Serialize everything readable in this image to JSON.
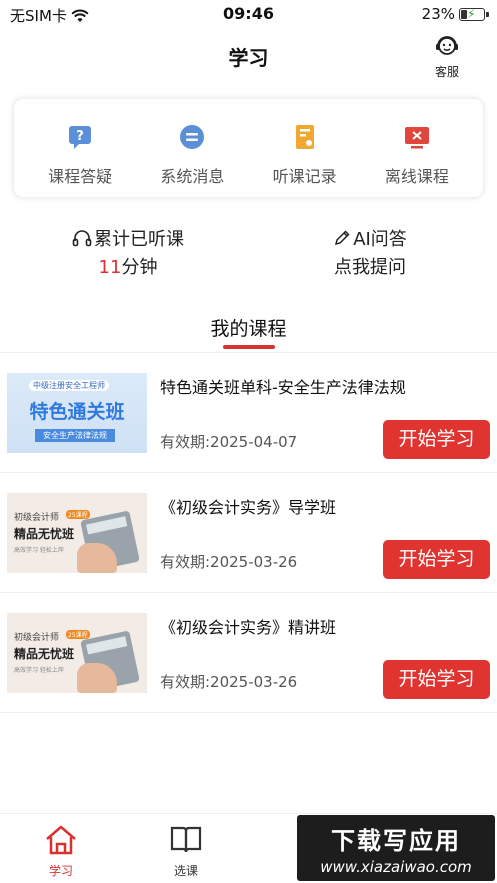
{
  "status_bar": {
    "carrier": "无SIM卡",
    "time": "09:46",
    "battery": "23%"
  },
  "nav": {
    "title": "学习",
    "service_label": "客服"
  },
  "quick_actions": [
    {
      "label": "课程答疑",
      "icon": "question-icon",
      "color": "#5b8fd8"
    },
    {
      "label": "系统消息",
      "icon": "message-icon",
      "color": "#5b8fd8"
    },
    {
      "label": "听课记录",
      "icon": "record-icon",
      "color": "#f0a830"
    },
    {
      "label": "离线课程",
      "icon": "offline-icon",
      "color": "#e0453e"
    }
  ],
  "stats": {
    "listened_label": "累计已听课",
    "listened_value": "11",
    "listened_unit": "分钟",
    "ai_label": "AI问答",
    "ai_action": "点我提问"
  },
  "section": {
    "title": "我的课程"
  },
  "courses": [
    {
      "name": "特色通关班单科-安全生产法律法规",
      "valid": "有效期:2025-04-07",
      "button": "开始学习",
      "thumb": {
        "tag": "中级注册安全工程师",
        "title": "特色通关班",
        "subtitle": "安全生产法律法规"
      }
    },
    {
      "name": "《初级会计实务》导学班",
      "valid": "有效期:2025-03-26",
      "button": "开始学习",
      "thumb": {
        "line1": "初级会计师",
        "tag": "25课程",
        "line2": "精品无忧班",
        "line3": "高效学习 轻松上岸"
      }
    },
    {
      "name": "《初级会计实务》精讲班",
      "valid": "有效期:2025-03-26",
      "button": "开始学习",
      "thumb": {
        "line1": "初级会计师",
        "tag": "25课程",
        "line2": "精品无忧班",
        "line3": "高效学习 轻松上岸"
      }
    }
  ],
  "tabbar": [
    {
      "label": "学习",
      "icon": "home-icon",
      "active": true
    },
    {
      "label": "选课",
      "icon": "book-icon",
      "active": false
    }
  ],
  "watermark": {
    "line1": "下载写应用",
    "line2": "www.xiazaiwao.com"
  },
  "colors": {
    "accent": "#d8312f",
    "button": "#e03431"
  }
}
